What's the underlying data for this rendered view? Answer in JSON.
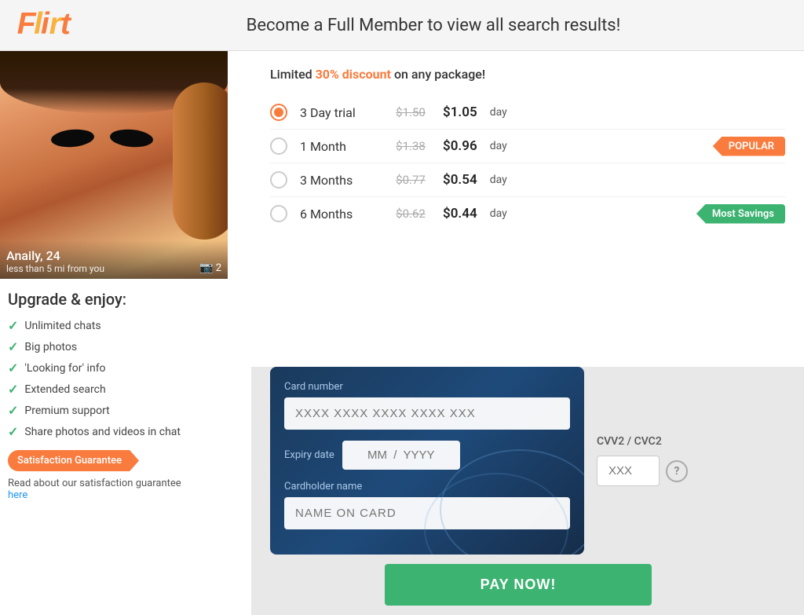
{
  "header": {
    "logo": "Flirt",
    "title": "Become a Full Member to view all search results!"
  },
  "profile": {
    "name": "Anaily",
    "age": "24",
    "distance": "less than 5 mi from you",
    "photo_count": "2"
  },
  "upgrade": {
    "title": "Upgrade & enjoy:",
    "features": [
      "Unlimited chats",
      "Big photos",
      "'Looking for' info",
      "Extended search",
      "Premium support",
      "Share photos and videos in chat"
    ],
    "satisfaction_badge": "Satisfaction Guarantee",
    "satisfaction_text": "Read about our satisfaction guarantee",
    "satisfaction_link": "here"
  },
  "pricing": {
    "discount_text_prefix": "Limited ",
    "discount_highlight": "30% discount",
    "discount_text_suffix": " on any package!",
    "plans": [
      {
        "id": "3day",
        "name": "3 Day trial",
        "original_price": "$1.50",
        "new_price": "$1.05",
        "per": "day",
        "selected": true,
        "badge": null
      },
      {
        "id": "1month",
        "name": "1 Month",
        "original_price": "$1.38",
        "new_price": "$0.96",
        "per": "day",
        "selected": false,
        "badge": "POPULAR",
        "badge_type": "popular"
      },
      {
        "id": "3months",
        "name": "3 Months",
        "original_price": "$0.77",
        "new_price": "$0.54",
        "per": "day",
        "selected": false,
        "badge": null
      },
      {
        "id": "6months",
        "name": "6 Months",
        "original_price": "$0.62",
        "new_price": "$0.44",
        "per": "day",
        "selected": false,
        "badge": "Most Savings",
        "badge_type": "savings"
      }
    ]
  },
  "payment": {
    "card_number_label": "Card number",
    "card_number_placeholder": "XXXX XXXX XXXX XXXX XXX",
    "expiry_label": "Expiry date",
    "expiry_placeholder": "MM  /  YYYY",
    "cardholder_label": "Cardholder name",
    "cardholder_placeholder": "NAME ON CARD",
    "cvv_label": "CVV2 / CVC2",
    "cvv_placeholder": "XXX",
    "pay_button": "PAY NOW!"
  },
  "colors": {
    "orange": "#f97b3d",
    "green": "#3cb371",
    "navy": "#1a3a5c",
    "highlight": "#f97b3d"
  }
}
